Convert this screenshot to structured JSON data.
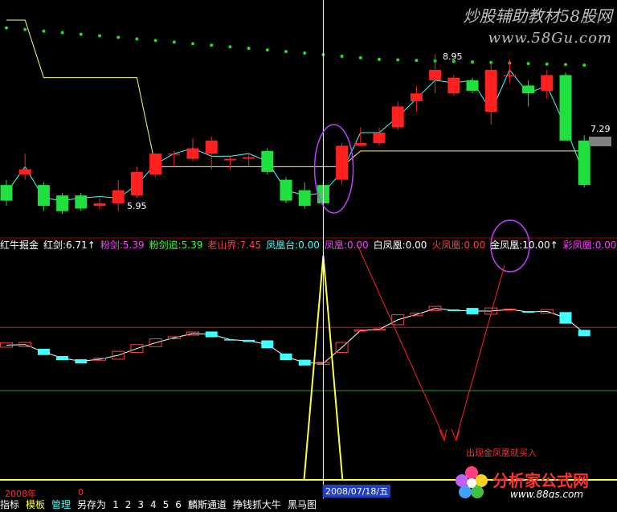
{
  "watermark": {
    "line1": "炒股辅助教材58股网",
    "line2": "www.58Gu.com"
  },
  "watermark_bottom": {
    "line1": "分析家公式网",
    "line2": "www.88gs.com"
  },
  "indicator_bar": {
    "items": [
      {
        "text": "红牛掘金",
        "color": "#ffffff"
      },
      {
        "text": "红剑:6.71↑",
        "color": "#ffffff"
      },
      {
        "text": "粉剑:5.39",
        "color": "#ff40ff"
      },
      {
        "text": "粉剑追:5.39",
        "color": "#40ff40"
      },
      {
        "text": "老山界:7.45",
        "color": "#ff4040"
      },
      {
        "text": "凤凰台:0.00",
        "color": "#40ffff"
      },
      {
        "text": "凤凰:0.00",
        "color": "#ff40ff"
      },
      {
        "text": "白凤凰:0.00",
        "color": "#ffffff"
      },
      {
        "text": "火凤凰:0.00",
        "color": "#ff4040"
      },
      {
        "text": "金凤凰:10.00↑",
        "color": "#ffffff"
      },
      {
        "text": "彩凤凰:0.00",
        "color": "#ff40ff"
      }
    ]
  },
  "annotations": {
    "high_price": "8.95",
    "low_price": "5.95",
    "last_price": "7.29",
    "year": "2008年",
    "zero": "0",
    "cursor_date": "2008/07/18/五",
    "note": "出现金凤凰就买入"
  },
  "bottom_bar": {
    "items": [
      "指标",
      "模板",
      "管理",
      "另存为",
      "1",
      "2",
      "3",
      "4",
      "5",
      "6",
      "麟斯通道",
      "挣钱抓大牛",
      "黑马图"
    ],
    "colors": [
      "#ffffff",
      "#ffff40",
      "#40ffff",
      "#ffffff",
      "#ffffff",
      "#ffffff",
      "#ffffff",
      "#ffffff",
      "#ffffff",
      "#ffffff",
      "#ffffff",
      "#ffffff",
      "#ffffff"
    ]
  },
  "chart_data": {
    "type": "candlestick",
    "candles": [
      {
        "o": 6.45,
        "c": 6.15,
        "h": 6.55,
        "l": 6.05
      },
      {
        "o": 6.65,
        "c": 6.75,
        "h": 7.05,
        "l": 6.55
      },
      {
        "o": 6.45,
        "c": 6.05,
        "h": 6.5,
        "l": 5.95
      },
      {
        "o": 6.25,
        "c": 5.95,
        "h": 6.3,
        "l": 5.9
      },
      {
        "o": 6.25,
        "c": 6.0,
        "h": 6.3,
        "l": 5.95
      },
      {
        "o": 6.05,
        "c": 6.1,
        "h": 6.2,
        "l": 5.98
      },
      {
        "o": 6.1,
        "c": 6.35,
        "h": 6.55,
        "l": 5.95
      },
      {
        "o": 6.25,
        "c": 6.7,
        "h": 6.8,
        "l": 6.2
      },
      {
        "o": 6.65,
        "c": 7.05,
        "h": 7.05,
        "l": 6.6
      },
      {
        "o": 7.05,
        "c": 7.05,
        "h": 7.1,
        "l": 6.8
      },
      {
        "o": 6.95,
        "c": 7.15,
        "h": 7.35,
        "l": 6.9
      },
      {
        "o": 7.05,
        "c": 7.3,
        "h": 7.38,
        "l": 6.75
      },
      {
        "o": 6.92,
        "c": 6.95,
        "h": 7.0,
        "l": 6.75
      },
      {
        "o": 6.95,
        "c": 6.98,
        "h": 7.05,
        "l": 6.8
      },
      {
        "o": 7.1,
        "c": 6.7,
        "h": 7.15,
        "l": 6.65
      },
      {
        "o": 6.55,
        "c": 6.15,
        "h": 6.6,
        "l": 6.1
      },
      {
        "o": 6.35,
        "c": 6.05,
        "h": 6.5,
        "l": 6.0
      },
      {
        "o": 6.45,
        "c": 6.1,
        "h": 6.5,
        "l": 6.05
      },
      {
        "o": 6.55,
        "c": 7.2,
        "h": 7.25,
        "l": 6.45
      },
      {
        "o": 7.2,
        "c": 7.25,
        "h": 7.55,
        "l": 7.2
      },
      {
        "o": 7.25,
        "c": 7.45,
        "h": 7.55,
        "l": 7.2
      },
      {
        "o": 7.55,
        "c": 7.95,
        "h": 8.05,
        "l": 7.5
      },
      {
        "o": 8.05,
        "c": 8.2,
        "h": 8.35,
        "l": 7.85
      },
      {
        "o": 8.45,
        "c": 8.65,
        "h": 8.95,
        "l": 8.2
      },
      {
        "o": 8.2,
        "c": 8.5,
        "h": 8.55,
        "l": 8.15
      },
      {
        "o": 8.45,
        "c": 8.25,
        "h": 8.5,
        "l": 8.2
      },
      {
        "o": 7.85,
        "c": 8.65,
        "h": 8.8,
        "l": 7.6
      },
      {
        "o": 8.55,
        "c": 8.55,
        "h": 8.85,
        "l": 8.4
      },
      {
        "o": 8.35,
        "c": 8.2,
        "h": 8.45,
        "l": 7.95
      },
      {
        "o": 8.25,
        "c": 8.55,
        "h": 8.65,
        "l": 8.1
      },
      {
        "o": 8.55,
        "c": 7.3,
        "h": 8.6,
        "l": 7.3
      },
      {
        "o": 7.3,
        "c": 6.45,
        "h": 7.4,
        "l": 6.4
      }
    ],
    "sub_candles": [
      {
        "o": 0.35,
        "c": 0.43
      },
      {
        "o": 0.36,
        "c": 0.44
      },
      {
        "o": 0.32,
        "c": 0.2
      },
      {
        "o": 0.18,
        "c": 0.1
      },
      {
        "o": 0.12,
        "c": 0.04
      },
      {
        "o": 0.1,
        "c": 0.14
      },
      {
        "o": 0.12,
        "c": 0.27
      },
      {
        "o": 0.25,
        "c": 0.4
      },
      {
        "o": 0.36,
        "c": 0.51
      },
      {
        "o": 0.51,
        "c": 0.55
      },
      {
        "o": 0.58,
        "c": 0.64
      },
      {
        "o": 0.65,
        "c": 0.54
      },
      {
        "o": 0.5,
        "c": 0.49
      },
      {
        "o": 0.49,
        "c": 0.45
      },
      {
        "o": 0.48,
        "c": 0.33
      },
      {
        "o": 0.23,
        "c": 0.1
      },
      {
        "o": 0.11,
        "c": 0.0
      },
      {
        "o": 0.02,
        "c": 0.06
      },
      {
        "o": 0.25,
        "c": 0.44
      },
      {
        "o": 0.66,
        "c": 0.68
      },
      {
        "o": 0.68,
        "c": 0.7
      },
      {
        "o": 0.78,
        "c": 0.97
      },
      {
        "o": 0.95,
        "c": 1.0
      },
      {
        "o": 1.05,
        "c": 1.13
      },
      {
        "o": 1.07,
        "c": 1.04
      },
      {
        "o": 1.1,
        "c": 0.98
      },
      {
        "o": 0.98,
        "c": 1.1
      },
      {
        "o": 1.06,
        "c": 1.08
      },
      {
        "o": 1.04,
        "c": 1.01
      },
      {
        "o": 1.0,
        "c": 1.07
      },
      {
        "o": 1.02,
        "c": 0.8
      },
      {
        "o": 0.68,
        "c": 0.56
      }
    ],
    "sub_hlines": [
      {
        "value": 0.73,
        "color": "#c02020"
      },
      {
        "value": -0.48,
        "color": "#20a020"
      }
    ],
    "spike": {
      "index": 17,
      "value": 10.0
    },
    "price_range": [
      5.5,
      9.8
    ],
    "sub_range": [
      -2.2,
      2.1
    ]
  }
}
